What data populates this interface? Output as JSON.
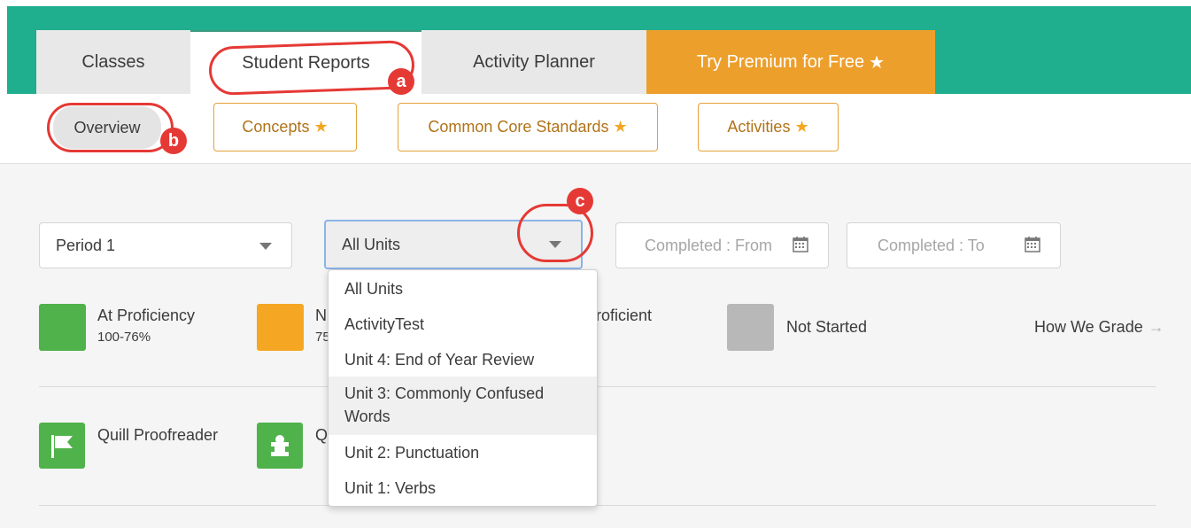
{
  "tabs": {
    "classes": "Classes",
    "student_reports": "Student Reports",
    "activity_planner": "Activity Planner",
    "premium": "Try Premium for Free"
  },
  "subnav": {
    "overview": "Overview",
    "concepts": "Concepts",
    "common_core": "Common Core Standards",
    "activities": "Activities"
  },
  "filters": {
    "period": "Period 1",
    "units": "All Units",
    "completed_from_placeholder": "Completed : From",
    "completed_to_placeholder": "Completed : To"
  },
  "legend": {
    "proficient_title": "At Proficiency",
    "proficient_range": "100-76%",
    "nearly_title_visible": "N",
    "nearly_range_visible": "75",
    "not_proficient_visible": "roficient",
    "not_started": "Not Started",
    "how_we_grade": "How We Grade",
    "how_arrow": "→"
  },
  "activity_types": {
    "proofreader": "Quill Proofreader",
    "grammar_visible": "Q"
  },
  "dropdown": {
    "options": [
      "All Units",
      "ActivityTest",
      "Unit 4: End of Year Review",
      "Unit 3: Commonly Confused Words",
      "Unit 2: Punctuation",
      "Unit 1: Verbs"
    ],
    "highlighted": "Unit 3: Commonly Confused Words"
  },
  "annotations": {
    "a": "a",
    "b": "b",
    "c": "c"
  },
  "colors": {
    "brand_green": "#1fae8e",
    "premium_orange": "#ed9f2c",
    "proficient": "#4fb24a",
    "nearly": "#f5a623",
    "not_started": "#b8b8b8",
    "annotation_red": "#e53935"
  },
  "icons": {
    "star": "★",
    "caret": "caret-down-icon",
    "calendar": "calendar-icon",
    "flag": "flag-icon",
    "puzzle": "puzzle-icon"
  }
}
